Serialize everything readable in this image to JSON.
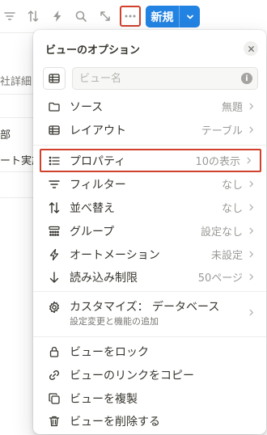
{
  "toolbar": {
    "icons": [
      "filter-icon",
      "sort-icon",
      "automation-icon",
      "search-icon",
      "expand-icon",
      "more-icon"
    ],
    "new_button_label": "新規"
  },
  "background": {
    "cell_1": "社詳細",
    "cell_2": "部",
    "cell_3": "ート実施"
  },
  "popup": {
    "title": "ビューのオプション",
    "name_placeholder": "ビュー名",
    "info_glyph": "i",
    "items": [
      {
        "label": "ソース",
        "value": "無題",
        "icon": "folder-icon"
      },
      {
        "label": "レイアウト",
        "value": "テーブル",
        "icon": "table-icon"
      },
      {
        "label": "プロパティ",
        "value": "10の表示",
        "icon": "list-icon"
      },
      {
        "label": "フィルター",
        "value": "なし",
        "icon": "filter-icon"
      },
      {
        "label": "並べ替え",
        "value": "なし",
        "icon": "sort-icon"
      },
      {
        "label": "グループ",
        "value": "設定なし",
        "icon": "group-icon"
      },
      {
        "label": "オートメーション",
        "value": "未設定",
        "icon": "automation-icon"
      },
      {
        "label": "読み込み制限",
        "value": "50ページ",
        "icon": "load-limit-icon"
      }
    ],
    "customize": {
      "title": "カスタマイズ： データベース",
      "subtitle": "設定変更と機能の追加",
      "icon": "gear-icon"
    },
    "actions": [
      {
        "label": "ビューをロック",
        "icon": "lock-icon"
      },
      {
        "label": "ビューのリンクをコピー",
        "icon": "link-icon"
      },
      {
        "label": "ビューを複製",
        "icon": "duplicate-icon"
      },
      {
        "label": "ビューを削除する",
        "icon": "trash-icon"
      }
    ]
  },
  "colors": {
    "accent_blue": "#2383e2",
    "highlight_red": "#d0402b",
    "text": "#37352f",
    "muted": "#9b9a97"
  }
}
